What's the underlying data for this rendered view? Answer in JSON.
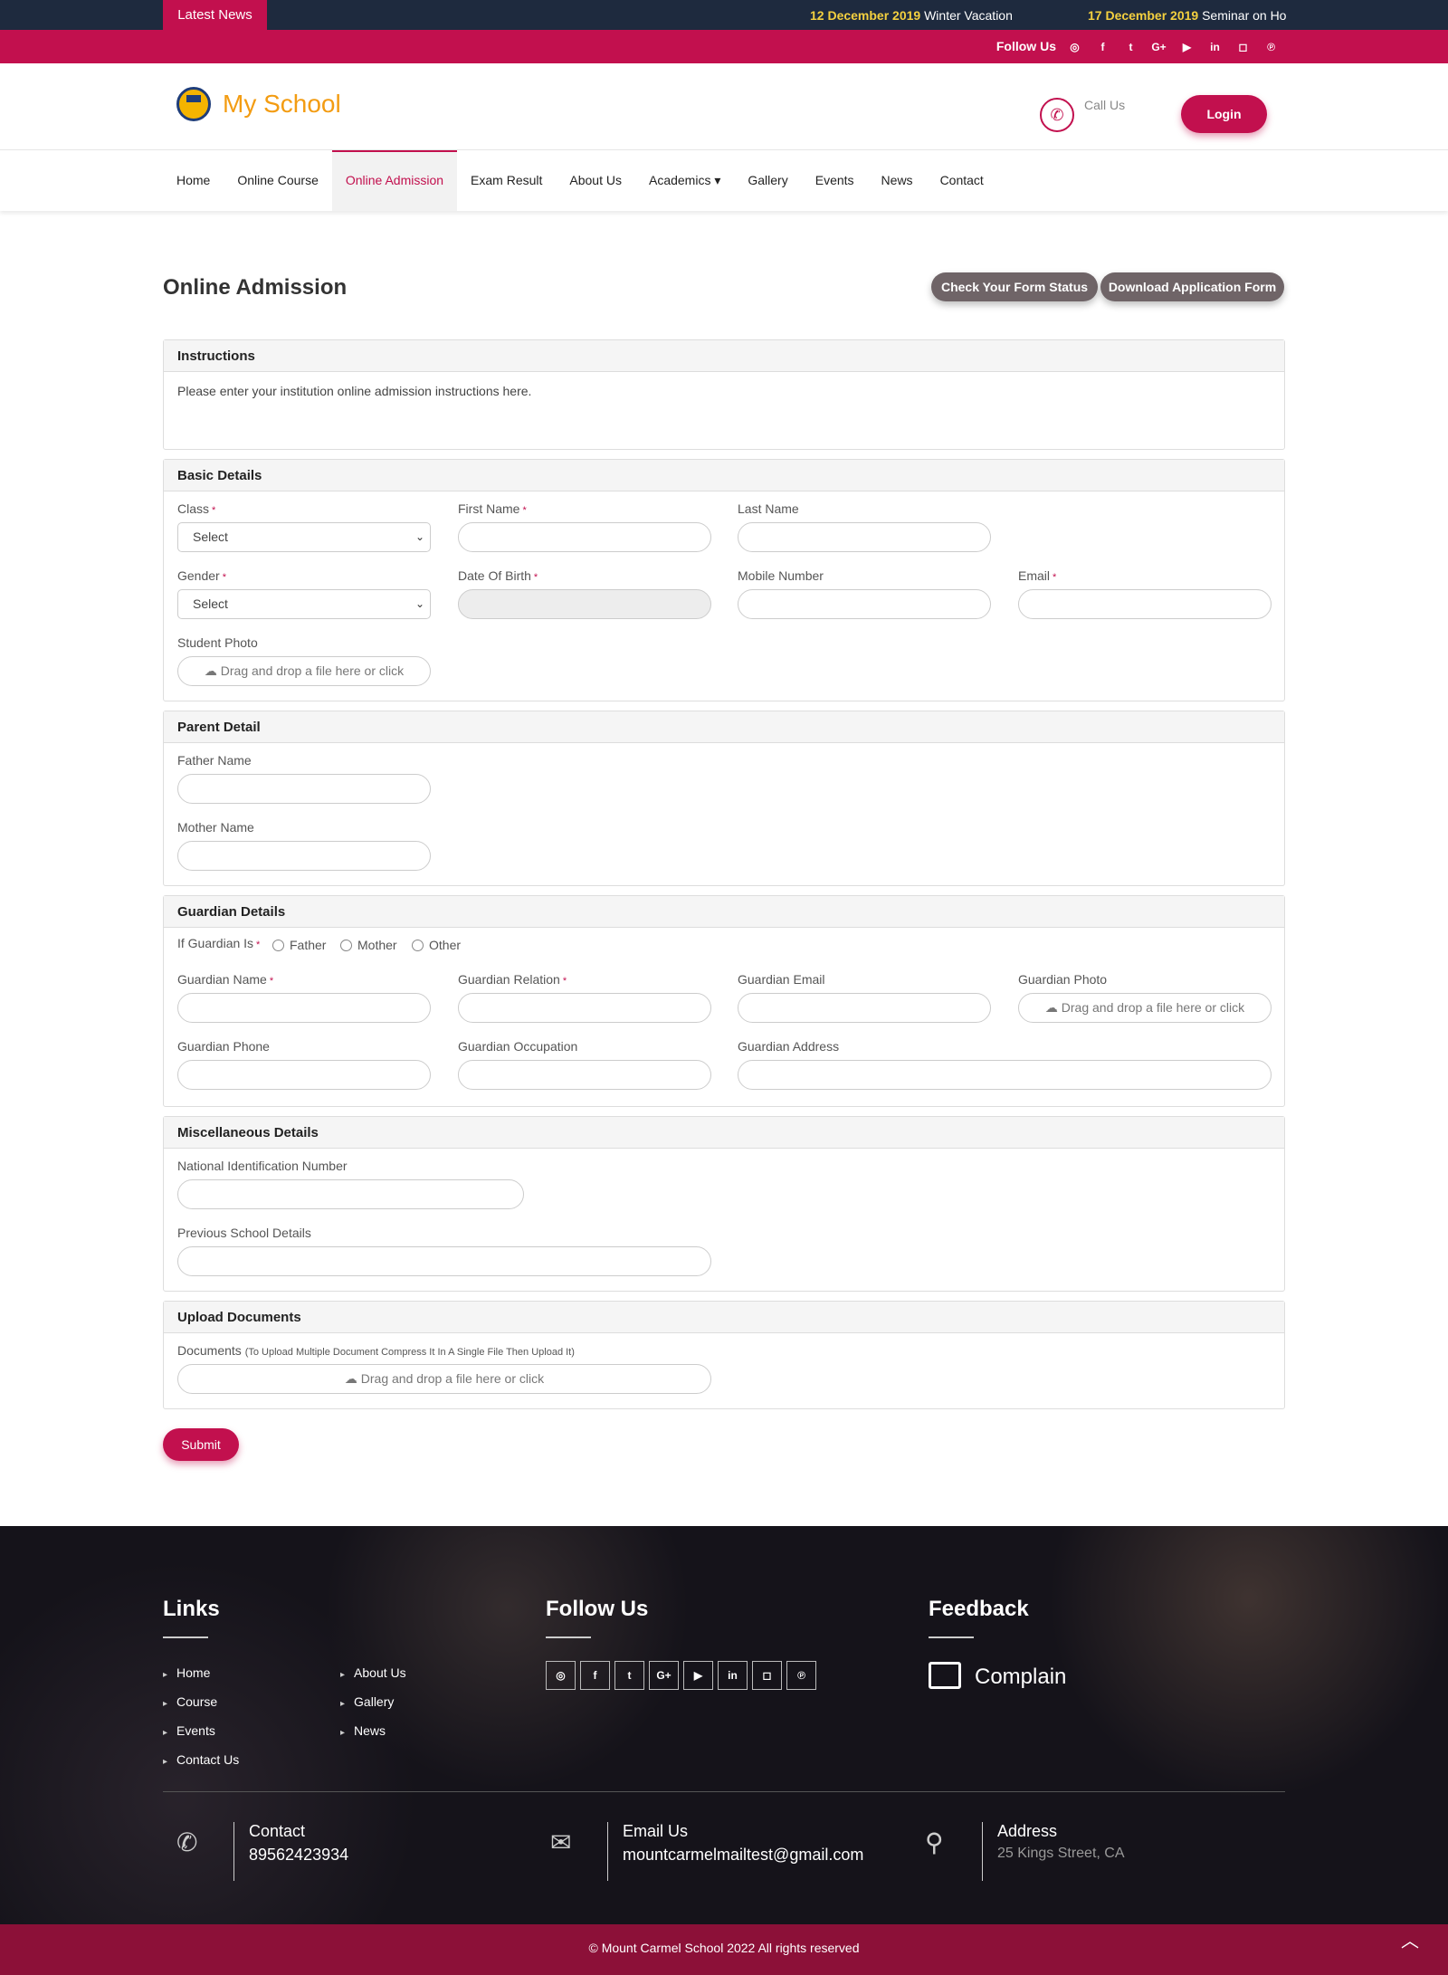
{
  "topbar": {
    "latest_label": "Latest News",
    "news": [
      {
        "date": "12 December 2019",
        "title": "Winter Vacation"
      },
      {
        "date": "17 December 2019",
        "title": "Seminar on Ho"
      }
    ]
  },
  "followbar": {
    "label": "Follow Us",
    "icons": [
      "whatsapp-icon",
      "facebook-icon",
      "twitter-icon",
      "google-plus-icon",
      "youtube-icon",
      "linkedin-icon",
      "instagram-icon",
      "pinterest-icon"
    ]
  },
  "header": {
    "logo_text": "My School",
    "call_label": "Call Us",
    "login_label": "Login"
  },
  "nav": {
    "items": [
      "Home",
      "Online Course",
      "Online Admission",
      "Exam Result",
      "About Us",
      "Academics ▾",
      "Gallery",
      "Events",
      "News",
      "Contact"
    ],
    "active": "Online Admission"
  },
  "page": {
    "title": "Online Admission",
    "check_status_label": "Check Your Form Status",
    "download_label": "Download Application Form"
  },
  "instructions": {
    "heading": "Instructions",
    "text": "Please enter your institution online admission instructions here."
  },
  "basic": {
    "heading": "Basic Details",
    "class_label": "Class",
    "first_name_label": "First Name",
    "last_name_label": "Last Name",
    "gender_label": "Gender",
    "dob_label": "Date Of Birth",
    "mobile_label": "Mobile Number",
    "email_label": "Email",
    "photo_label": "Student Photo",
    "select_text": "Select",
    "drop_text": "Drag and drop a file here or click"
  },
  "parent": {
    "heading": "Parent Detail",
    "father_label": "Father Name",
    "mother_label": "Mother Name"
  },
  "guardian": {
    "heading": "Guardian Details",
    "if_label": "If Guardian Is",
    "options": [
      "Father",
      "Mother",
      "Other"
    ],
    "name_label": "Guardian Name",
    "relation_label": "Guardian Relation",
    "email_label": "Guardian Email",
    "photo_label": "Guardian Photo",
    "phone_label": "Guardian Phone",
    "occupation_label": "Guardian Occupation",
    "address_label": "Guardian Address"
  },
  "misc": {
    "heading": "Miscellaneous Details",
    "nin_label": "National Identification Number",
    "prev_label": "Previous School Details"
  },
  "upload": {
    "heading": "Upload Documents",
    "label": "Documents",
    "hint": "(To Upload Multiple Document Compress It In A Single File Then Upload It)"
  },
  "submit_label": "Submit",
  "footer": {
    "links_heading": "Links",
    "links_col1": [
      "Home",
      "Course",
      "Events",
      "Contact Us"
    ],
    "links_col2": [
      "About Us",
      "Gallery",
      "News"
    ],
    "follow_heading": "Follow Us",
    "feedback_heading": "Feedback",
    "complain_label": "Complain",
    "contact_title": "Contact",
    "contact_value": "89562423934",
    "email_title": "Email Us",
    "email_value": "mountcarmelmailtest@gmail.com",
    "address_title": "Address",
    "address_value": "25 Kings Street, CA",
    "copyright": "© Mount Carmel School 2022 All rights reserved"
  }
}
